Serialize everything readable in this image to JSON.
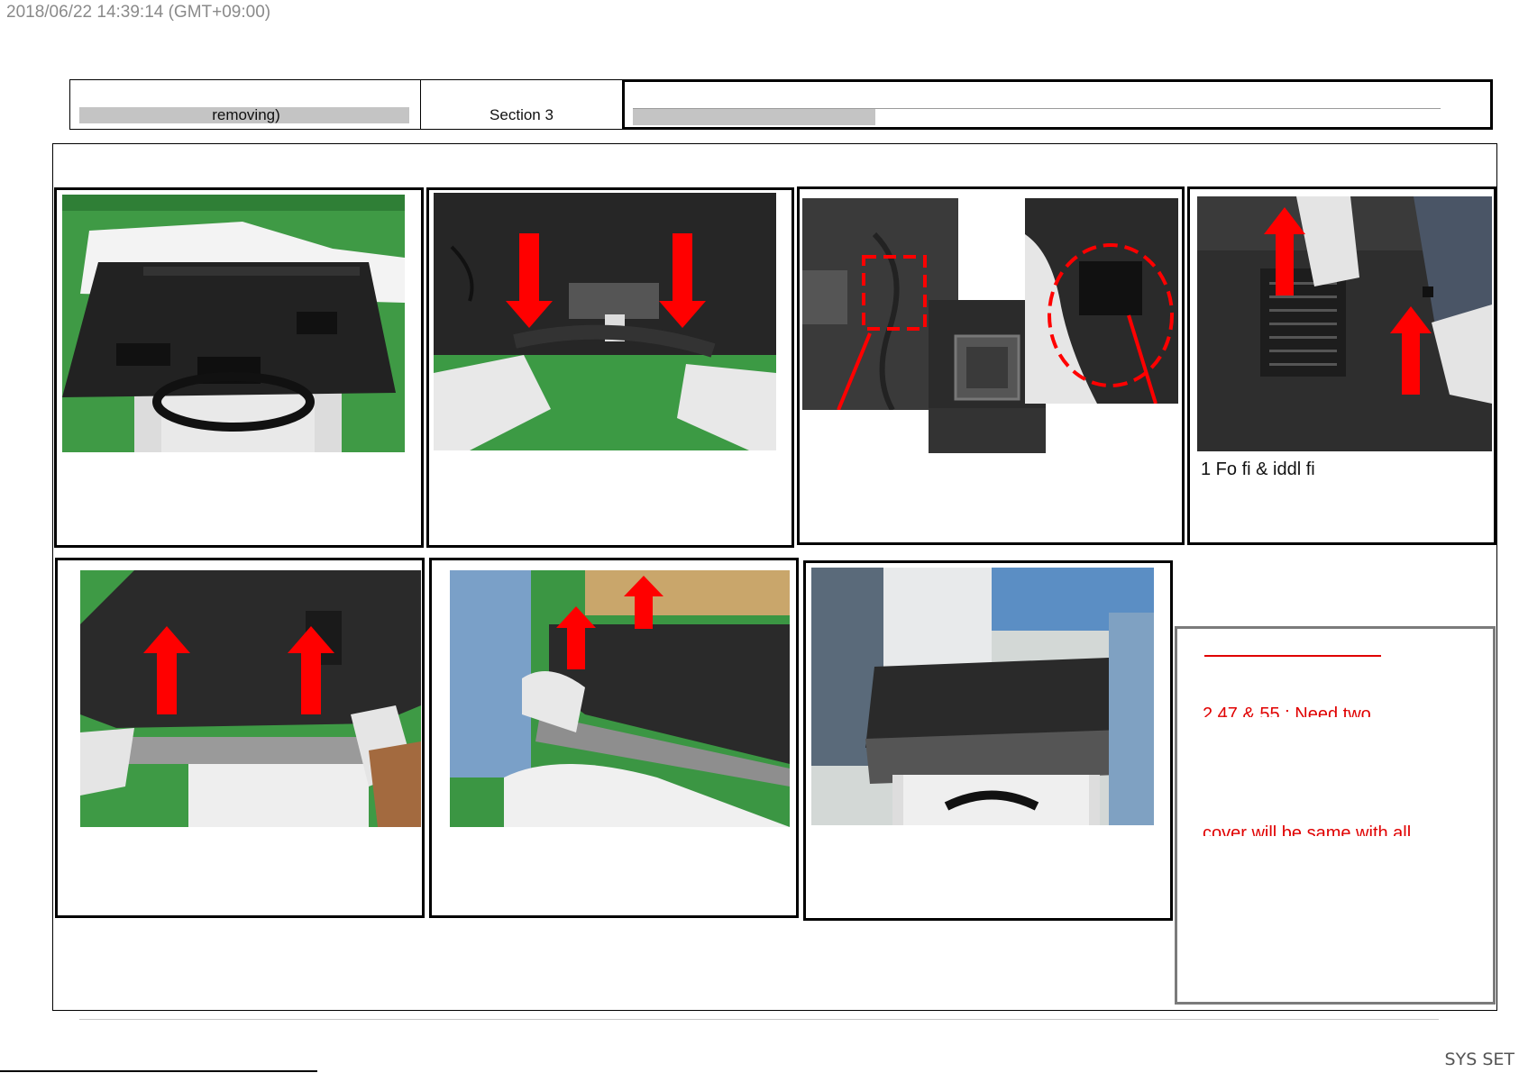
{
  "page": {
    "timestamp": "2018/06/22 14:39:14 (GMT+09:00)",
    "footer_label": "SYS SET"
  },
  "header": {
    "cell1_text": "removing)",
    "cell2_text": "Section 3"
  },
  "panels": [
    {
      "id": 1,
      "caption": ""
    },
    {
      "id": 2,
      "caption": ""
    },
    {
      "id": 3,
      "caption": ""
    },
    {
      "id": 4,
      "caption": "1    Fo  fi          &   iddl   fi"
    },
    {
      "id": 5,
      "caption": ""
    },
    {
      "id": 6,
      "caption": ""
    },
    {
      "id": 7,
      "caption": ""
    }
  ],
  "note": {
    "line1": "2    47  & 55   : Need two",
    "line2": "     cover will be same with all"
  },
  "colors": {
    "accent_red": "#e00000",
    "arrow_red": "#ff0000",
    "green_floor": "#3e9b3e"
  }
}
